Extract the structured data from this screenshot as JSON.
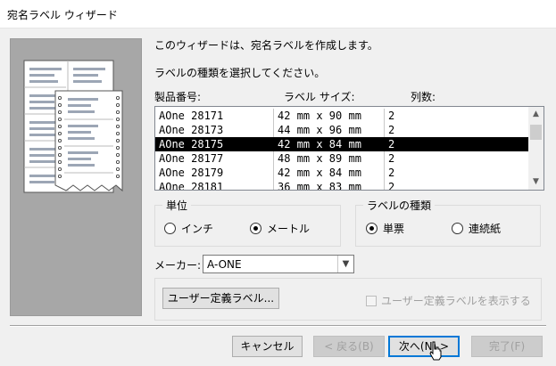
{
  "window": {
    "title": "宛名ラベル ウィザード"
  },
  "intro": {
    "line1": "このウィザードは、宛名ラベルを作成します。",
    "line2": "ラベルの種類を選択してください。"
  },
  "list": {
    "headers": [
      "製品番号:",
      "ラベル サイズ:",
      "列数:"
    ],
    "rows": [
      [
        "AOne 28171",
        "42 mm x 90 mm",
        "2"
      ],
      [
        "AOne 28173",
        "44 mm x 96 mm",
        "2"
      ],
      [
        "AOne 28175",
        "42 mm x 84 mm",
        "2"
      ],
      [
        "AOne 28177",
        "48 mm x 89 mm",
        "2"
      ],
      [
        "AOne 28179",
        "42 mm x 84 mm",
        "2"
      ],
      [
        "AOne 28181",
        "36 mm x 83 mm",
        "2"
      ]
    ],
    "selected_index": 2
  },
  "unit": {
    "legend": "単位",
    "options": [
      "インチ",
      "メートル"
    ],
    "selected": "メートル"
  },
  "label_type": {
    "legend": "ラベルの種類",
    "options": [
      "単票",
      "連続紙"
    ],
    "selected": "単票"
  },
  "manufacturer": {
    "label": "メーカー:",
    "value": "A-ONE"
  },
  "custom_labels_button": "ユーザー定義ラベル...",
  "show_custom_checkbox": {
    "label": "ユーザー定義ラベルを表示する",
    "checked": false,
    "enabled": false
  },
  "buttons": {
    "cancel": "キャンセル",
    "back": "< 戻る(B)",
    "next": "次へ(N) >",
    "finish": "完了(F)"
  },
  "colors": {
    "selection_bg": "#000000",
    "focus_border": "#0078d7",
    "art_bg": "#a7a7a7"
  }
}
